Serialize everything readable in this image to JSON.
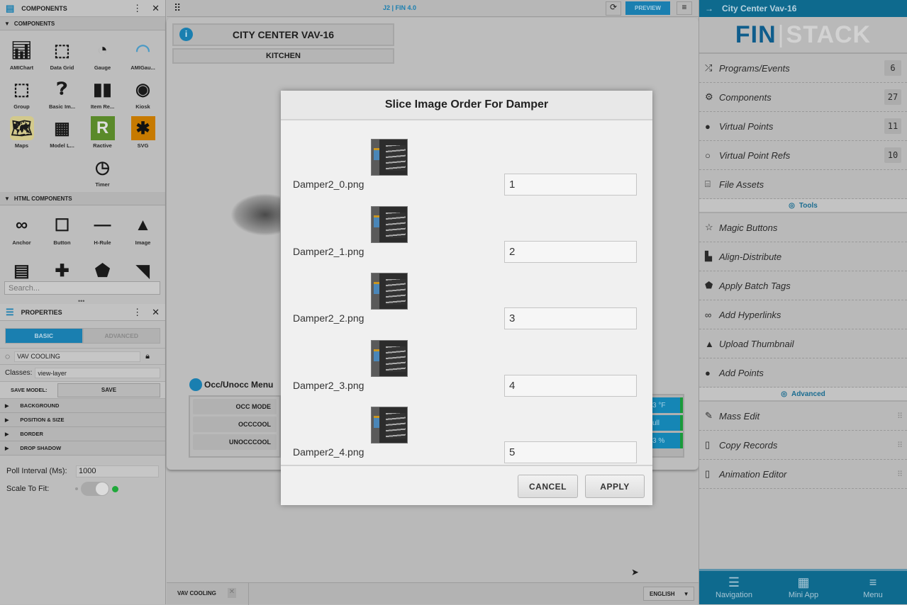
{
  "components_panel": {
    "title": "COMPONENTS",
    "section": "COMPONENTS",
    "items": [
      {
        "label": "AMIChart",
        "icon": "chart-icon"
      },
      {
        "label": "Data Grid",
        "icon": "data-grid-icon"
      },
      {
        "label": "Gauge",
        "icon": "gauge-icon"
      },
      {
        "label": "AMIGau...",
        "icon": "ami-gauge-icon"
      },
      {
        "label": "Group",
        "icon": "group-icon"
      },
      {
        "label": "Basic Im...",
        "icon": "question-icon"
      },
      {
        "label": "Item Re...",
        "icon": "item-repeater-icon"
      },
      {
        "label": "Kiosk",
        "icon": "kiosk-icon"
      },
      {
        "label": "Maps",
        "icon": "maps-icon"
      },
      {
        "label": "Model L...",
        "icon": "model-layout-icon"
      },
      {
        "label": "Ractive",
        "icon": "ractive-icon"
      },
      {
        "label": "SVG",
        "icon": "svg-icon"
      },
      {
        "label": "Timer",
        "icon": "timer-icon"
      }
    ],
    "html_section": "HTML COMPONENTS",
    "html_items": [
      {
        "label": "Anchor",
        "icon": "link-icon"
      },
      {
        "label": "Button",
        "icon": "button-icon"
      },
      {
        "label": "H-Rule",
        "icon": "hrule-icon"
      },
      {
        "label": "Image",
        "icon": "image-icon"
      },
      {
        "label": "",
        "icon": "layout-icon"
      },
      {
        "label": "",
        "icon": "plus-icon"
      },
      {
        "label": "",
        "icon": "tag-icon"
      },
      {
        "label": "",
        "icon": "wifi-icon"
      }
    ],
    "search_placeholder": "Search..."
  },
  "properties": {
    "title": "PROPERTIES",
    "tabs": [
      "BASIC",
      "ADVANCED"
    ],
    "name": "VAV COOLING",
    "classes_label": "Classes:",
    "classes": "view-layer",
    "save_model_label": "SAVE MODEL:",
    "save": "SAVE",
    "sections": [
      "BACKGROUND",
      "POSITION & SIZE",
      "BORDER",
      "DROP SHADOW"
    ],
    "poll_label": "Poll Interval (Ms):",
    "poll_value": "1000",
    "scale_label": "Scale To Fit:",
    "scale_to_fit": true
  },
  "topbar": {
    "title": "J2 | FIN 4.0",
    "preview": "PREVIEW"
  },
  "canvas": {
    "title": "CITY CENTER VAV-16",
    "subtitle": "KITCHEN",
    "menu_title": "Occ/Unocc Menu",
    "menu_items": [
      "OCC MODE",
      "OCCCOOL",
      "UNOCCCOOL"
    ],
    "values": [
      "3 °F",
      "ull",
      "3 %"
    ]
  },
  "bottom": {
    "tab": "VAV COOLING",
    "language": "ENGLISH"
  },
  "dialog": {
    "title": "Slice Image Order For Damper",
    "rows": [
      {
        "file": "Damper2_0.png",
        "order": "1"
      },
      {
        "file": "Damper2_1.png",
        "order": "2"
      },
      {
        "file": "Damper2_2.png",
        "order": "3"
      },
      {
        "file": "Damper2_3.png",
        "order": "4"
      },
      {
        "file": "Damper2_4.png",
        "order": "5"
      }
    ],
    "cancel": "CANCEL",
    "apply": "APPLY"
  },
  "right": {
    "header": "City Center Vav-16",
    "logo": "FIN|STACK",
    "items": [
      {
        "label": "Programs/Events",
        "count": "6",
        "icon": "shuffle-icon"
      },
      {
        "label": "Components",
        "count": "27",
        "icon": "gear-icon"
      },
      {
        "label": "Virtual Points",
        "count": "11",
        "icon": "pin-icon"
      },
      {
        "label": "Virtual Point Refs",
        "count": "10",
        "icon": "pin-outline-icon"
      },
      {
        "label": "File Assets",
        "icon": "archive-icon"
      }
    ],
    "tools_label": "Tools",
    "tools": [
      {
        "label": "Magic Buttons",
        "icon": "star-icon"
      },
      {
        "label": "Align-Distribute",
        "icon": "align-icon"
      },
      {
        "label": "Apply Batch Tags",
        "icon": "tag-icon"
      },
      {
        "label": "Add Hyperlinks",
        "icon": "link-icon"
      },
      {
        "label": "Upload Thumbnail",
        "icon": "image-icon"
      },
      {
        "label": "Add Points",
        "icon": "pin-icon"
      }
    ],
    "advanced_label": "Advanced",
    "advanced": [
      {
        "label": "Mass Edit",
        "icon": "edit-icon"
      },
      {
        "label": "Copy Records",
        "icon": "clipboard-icon"
      },
      {
        "label": "Animation Editor",
        "icon": "clipboard-icon"
      }
    ],
    "nav": [
      "Navigation",
      "Mini App",
      "Menu"
    ]
  },
  "colors": {
    "accent": "#1a7fb0",
    "header_blue": "#0e6a8e",
    "toggle_on": "#1fa83a"
  }
}
